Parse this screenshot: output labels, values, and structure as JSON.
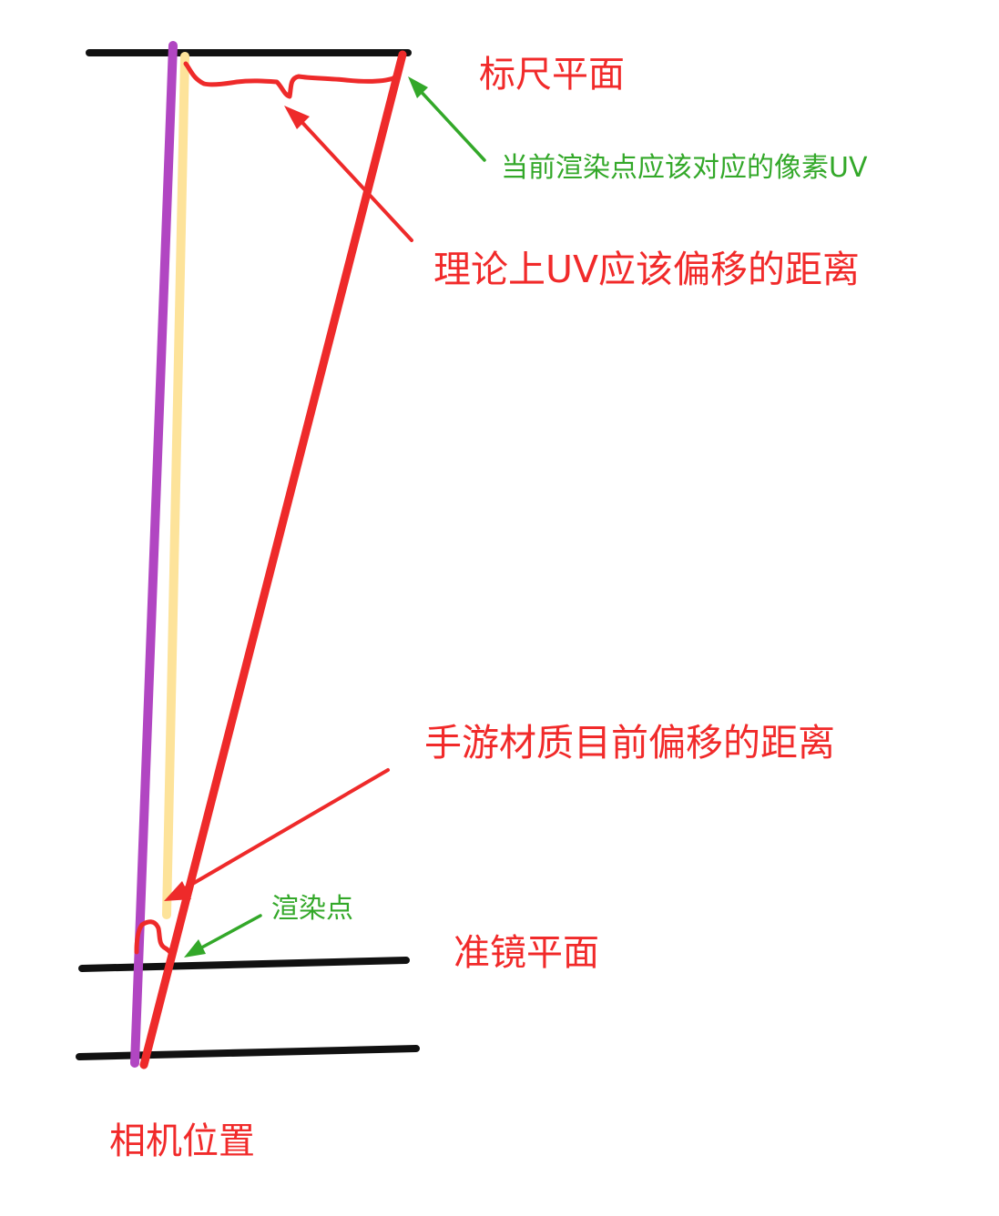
{
  "labels": {
    "ruler_plane": "标尺平面",
    "current_pixel_uv": "当前渲染点应该对应的像素UV",
    "theoretical_offset": "理论上UV应该偏移的距离",
    "mobile_material_offset": "手游材质目前偏移的距离",
    "render_point": "渲染点",
    "focus_plane": "准镜平面",
    "camera_position": "相机位置"
  },
  "colors": {
    "plane_lines": "#111111",
    "label_red": "#f12a2a",
    "label_green": "#33a829",
    "purple_line": "#b146c2",
    "yellow_line": "#fde39a",
    "red_line": "#ee2a2a",
    "green_arrow": "#33a829"
  }
}
